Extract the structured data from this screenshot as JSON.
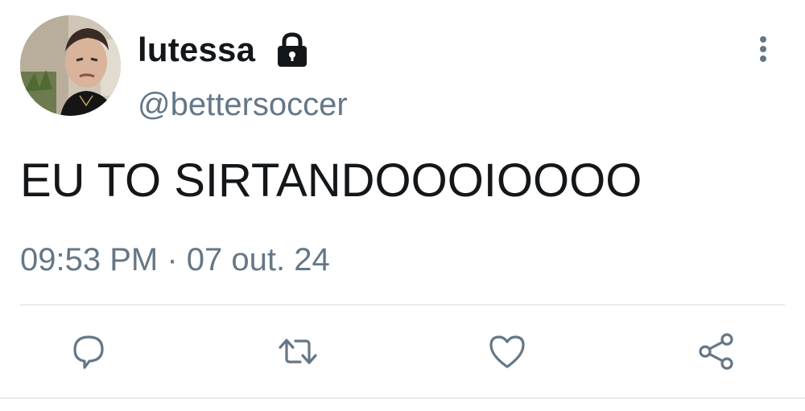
{
  "tweet": {
    "display_name": "lutessa",
    "handle": "@bettersoccer",
    "text": "EU TO SIRTANDOOOIOOOO",
    "time": "09:53 PM",
    "separator": "·",
    "date": "07 out. 24"
  },
  "icons": {
    "lock": "lock-icon",
    "more": "more-vertical-icon",
    "reply": "reply-icon",
    "retweet": "retweet-icon",
    "like": "heart-icon",
    "share": "share-icon"
  },
  "colors": {
    "text_primary": "#14171a",
    "text_secondary": "#657786",
    "divider": "#e6ecf0"
  }
}
